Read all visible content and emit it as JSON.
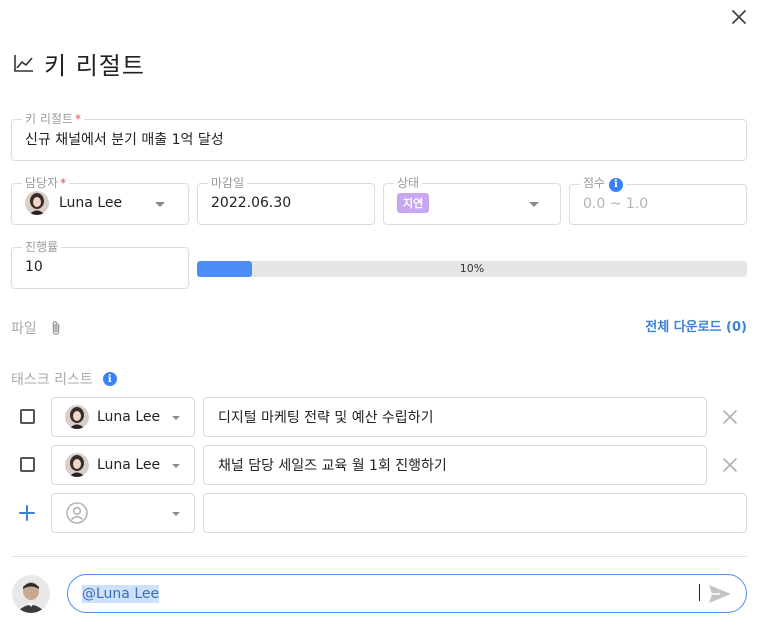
{
  "header": {
    "title": "키 리절트"
  },
  "key_result": {
    "label": "키 리절트",
    "required_mark": "*",
    "value": "신규 채널에서 분기 매출 1억 달성"
  },
  "assignee": {
    "label": "담당자",
    "required_mark": "*",
    "name": "Luna Lee"
  },
  "due_date": {
    "label": "마감일",
    "value": "2022.06.30"
  },
  "status": {
    "label": "상태",
    "value": "지연",
    "color": "#c7a7f2"
  },
  "score": {
    "label": "점수",
    "placeholder": "0.0 ~ 1.0"
  },
  "progress": {
    "label": "진행률",
    "value": "10",
    "percent_text": "10%",
    "fraction": 0.1,
    "fill_color": "#4b8df5"
  },
  "files": {
    "label": "파일",
    "download_label": "전체 다운로드 (0)"
  },
  "task_list": {
    "label": "태스크 리스트",
    "tasks": [
      {
        "assignee": "Luna Lee",
        "text": "디지털 마케팅 전략 및 예산 수립하기"
      },
      {
        "assignee": "Luna Lee",
        "text": "채널 담당 세일즈 교육 월 1회 진행하기"
      }
    ]
  },
  "comment": {
    "mention": "@Luna Lee"
  },
  "colors": {
    "accent": "#3b82d6",
    "border": "#dcdcdc",
    "required": "#e5484d"
  }
}
